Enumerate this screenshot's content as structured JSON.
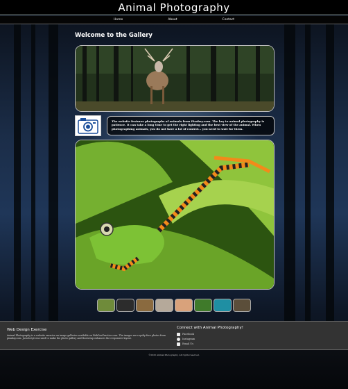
{
  "header": {
    "title": "Animal Photography"
  },
  "nav": {
    "items": [
      {
        "label": "Home"
      },
      {
        "label": "About"
      },
      {
        "label": "Contact"
      }
    ]
  },
  "main": {
    "welcome": "Welcome to the Gallery",
    "intro": "The website features photographs of animals from Pixabay.com. The key to animal photography is patience. It can take a long time to get the right lighting and the best view of the animal. When photographing animals, you do not have a lot of control... you need to wait for them."
  },
  "gallery": {
    "thumbnails": [
      {
        "color": "#6f8b3a"
      },
      {
        "color": "#2c2c2c"
      },
      {
        "color": "#8a6a3f"
      },
      {
        "color": "#b5a99a"
      },
      {
        "color": "#d9a27b"
      },
      {
        "color": "#3f7a2a"
      },
      {
        "color": "#1f8fa3"
      },
      {
        "color": "#5b4e3a"
      }
    ]
  },
  "footer": {
    "title": "Web Design Exercise",
    "text": "Animal Photography is a website exercise on image galleries available on WebDevPractice.com. The images are royalty-free photos from pixabay.com. JavaScript was used to make the photo gallery and Bootstrap enhances the responsive layout.",
    "connect_title": "Connect with Animal Photography!",
    "social": [
      {
        "label": "Facebook"
      },
      {
        "label": "Instagram"
      },
      {
        "label": "Email Us"
      }
    ]
  },
  "copyright": "©2020 Animal Photography. All rights reserved."
}
